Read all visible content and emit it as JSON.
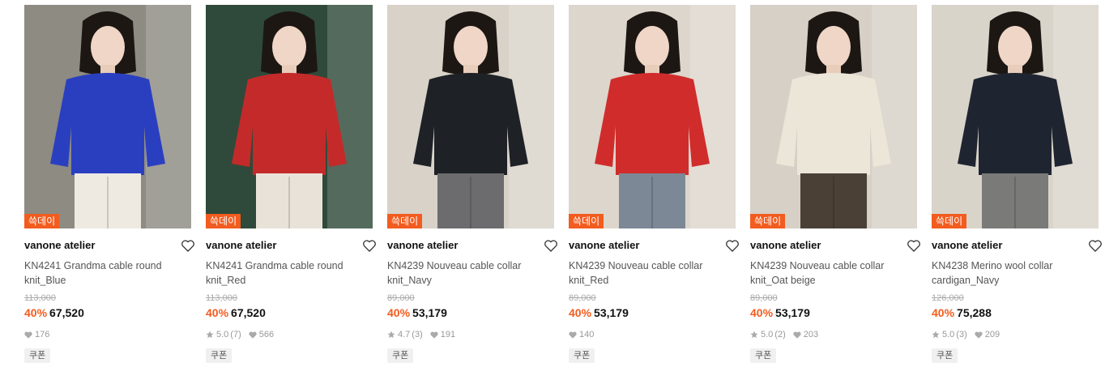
{
  "colors": {
    "accent": "#f25c1f",
    "price": "#111111",
    "muted": "#999999"
  },
  "products": [
    {
      "badge": "쓱데이",
      "brand": "vanone atelier",
      "name": "KN4241 Grandma cable round knit_Blue",
      "original_price": "113,000",
      "discount": "40%",
      "price": "67,520",
      "rating": "",
      "reviews": "",
      "likes": "176",
      "coupon": "쿠폰",
      "knit_color": "#2a3fc0",
      "bottom_color": "#eeeae2",
      "bg_color": "#8d8b82"
    },
    {
      "badge": "쓱데이",
      "brand": "vanone atelier",
      "name": "KN4241 Grandma cable round knit_Red",
      "original_price": "113,000",
      "discount": "40%",
      "price": "67,520",
      "rating": "5.0",
      "reviews": "(7)",
      "likes": "566",
      "coupon": "쿠폰",
      "knit_color": "#c42a2a",
      "bottom_color": "#e9e2d8",
      "bg_color": "#2f4a3a"
    },
    {
      "badge": "쓱데이",
      "brand": "vanone atelier",
      "name": "KN4239 Nouveau cable collar knit_Navy",
      "original_price": "89,000",
      "discount": "40%",
      "price": "53,179",
      "rating": "4.7",
      "reviews": "(3)",
      "likes": "191",
      "coupon": "쿠폰",
      "knit_color": "#1e2226",
      "bottom_color": "#6c6c6e",
      "bg_color": "#d8d2c8"
    },
    {
      "badge": "쓱데이",
      "brand": "vanone atelier",
      "name": "KN4239 Nouveau cable collar knit_Red",
      "original_price": "89,000",
      "discount": "40%",
      "price": "53,179",
      "rating": "",
      "reviews": "",
      "likes": "140",
      "coupon": "쿠폰",
      "knit_color": "#d02c2c",
      "bottom_color": "#7c8896",
      "bg_color": "#ddd6cc"
    },
    {
      "badge": "쓱데이",
      "brand": "vanone atelier",
      "name": "KN4239 Nouveau cable collar knit_Oat beige",
      "original_price": "89,000",
      "discount": "40%",
      "price": "53,179",
      "rating": "5.0",
      "reviews": "(2)",
      "likes": "203",
      "coupon": "쿠폰",
      "knit_color": "#ece6d8",
      "bottom_color": "#4a4036",
      "bg_color": "#d6d0c6"
    },
    {
      "badge": "쓱데이",
      "brand": "vanone atelier",
      "name": "KN4238 Merino wool collar cardigan_Navy",
      "original_price": "126,000",
      "discount": "40%",
      "price": "75,288",
      "rating": "5.0",
      "reviews": "(3)",
      "likes": "209",
      "coupon": "쿠폰",
      "knit_color": "#1f2530",
      "bottom_color": "#7a7a78",
      "bg_color": "#d9d4ca"
    }
  ]
}
